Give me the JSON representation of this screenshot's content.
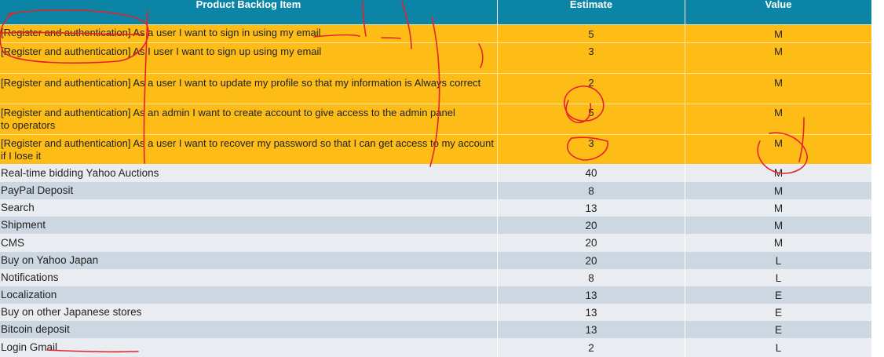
{
  "table": {
    "headers": [
      "Product Backlog Item",
      "Estimate",
      "Value"
    ],
    "highlighted_rows": [
      {
        "item": "[Register and authentication] As a user I want to sign in using my email",
        "estimate": "5",
        "value": "M"
      },
      {
        "item": "[Register and authentication] As I user I want to sign up using my email",
        "estimate": "3",
        "value": "M"
      },
      {
        "item": "[Register and authentication] As a user I want to update my profile so that my information is Always correct",
        "estimate": "2",
        "value": "M"
      },
      {
        "item": "[Register and authentication] As an admin I want to create account to give access to the admin panel to operators",
        "estimate": "5",
        "value": "M"
      },
      {
        "item": "[Register and authentication] As a user I want to recover my password so that I can get access to my account if I lose it",
        "estimate": "3",
        "value": "M"
      }
    ],
    "rows": [
      {
        "item": "Real-time bidding Yahoo Auctions",
        "estimate": "40",
        "value": "M"
      },
      {
        "item": "PayPal Deposit",
        "estimate": "8",
        "value": "M"
      },
      {
        "item": "Search",
        "estimate": "13",
        "value": "M"
      },
      {
        "item": "Shipment",
        "estimate": "20",
        "value": "M"
      },
      {
        "item": "CMS",
        "estimate": "20",
        "value": "M"
      },
      {
        "item": "Buy on Yahoo Japan",
        "estimate": "20",
        "value": "L"
      },
      {
        "item": "Notifications",
        "estimate": "8",
        "value": "L"
      },
      {
        "item": "Localization",
        "estimate": "13",
        "value": "E"
      },
      {
        "item": "Buy on other Japanese stores",
        "estimate": "13",
        "value": "E"
      },
      {
        "item": "Bitcoin deposit",
        "estimate": "13",
        "value": "E"
      },
      {
        "item": "Login Gmail",
        "estimate": "2",
        "value": "L"
      }
    ]
  },
  "colors": {
    "header": "#0b84a5",
    "highlight": "#fdbd16",
    "row_light": "#e9edf1",
    "row_dark": "#ccd7e1",
    "ink": "#e8202a"
  }
}
